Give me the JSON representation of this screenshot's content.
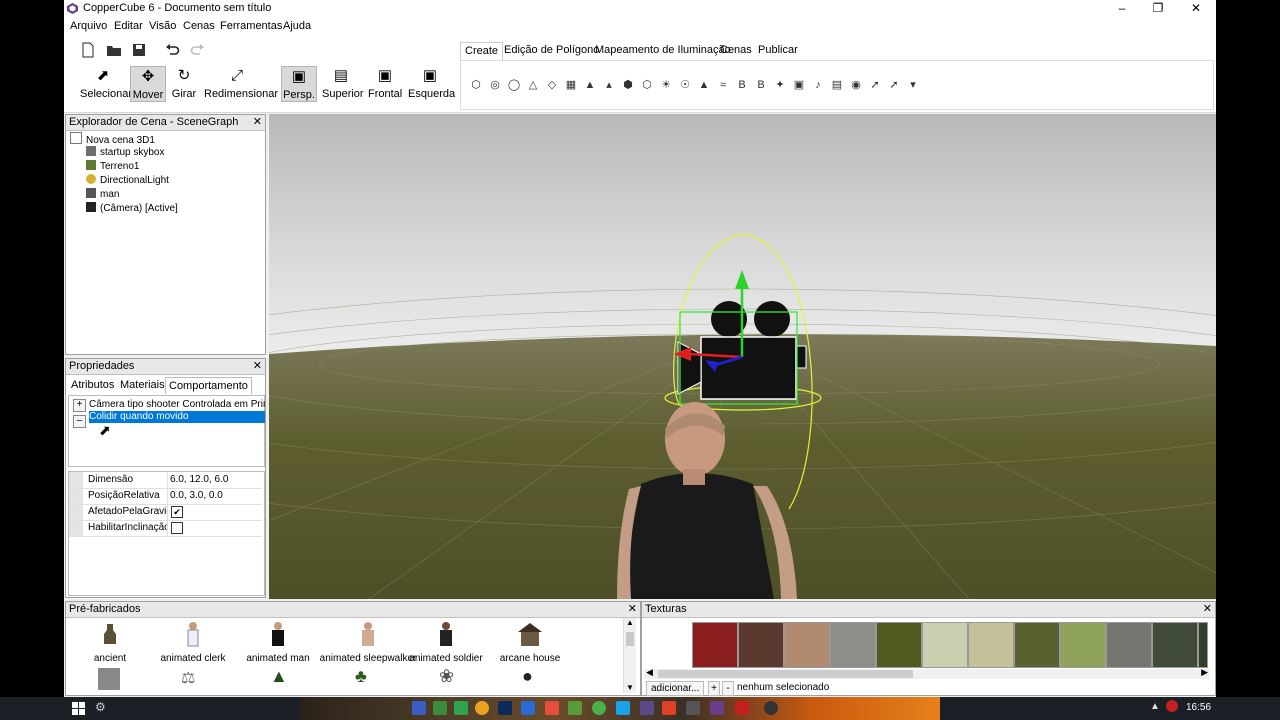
{
  "window": {
    "title": "CopperCube 6 - Documento sem título"
  },
  "menu": [
    "Arquivo",
    "Editar",
    "Visão",
    "Cenas",
    "Ferramentas",
    "Ajuda"
  ],
  "tools": [
    {
      "label": "Selecionar",
      "icon": "cursor-icon"
    },
    {
      "label": "Mover",
      "icon": "move-icon",
      "selected": true
    },
    {
      "label": "Girar",
      "icon": "rotate-icon"
    },
    {
      "label": "Redimensionar",
      "icon": "resize-icon"
    },
    {
      "label": "Persp.",
      "icon": "perspective-icon",
      "selected": true
    },
    {
      "label": "Superior",
      "icon": "top-view-icon"
    },
    {
      "label": "Frontal",
      "icon": "front-view-icon"
    },
    {
      "label": "Esquerda",
      "icon": "left-view-icon"
    }
  ],
  "ribbon_tabs": [
    "Create",
    "Edição de Polígono",
    "Mapeamento de Iluminação",
    "Cenas",
    "Publicar"
  ],
  "ribbon_active": "Create",
  "scene_explorer": {
    "title": "Explorador de Cena - SceneGraph",
    "items": [
      "Nova cena 3D1",
      "startup skybox",
      "Terreno1",
      "DirectionalLight",
      "man",
      "(Câmera) [Active]"
    ]
  },
  "properties": {
    "title": "Propriedades",
    "tabs": [
      "Atributos",
      "Materiais",
      "Comportamento"
    ],
    "active_tab": "Comportamento",
    "behaviors": [
      "Câmera tipo shooter Controlada em Prim",
      "Colidir quando movido"
    ],
    "selected_behavior": "Colidir quando movido",
    "rows": [
      {
        "key": "Dimensão",
        "value": "6.0, 12.0, 6.0"
      },
      {
        "key": "PosiçãoRelativa",
        "value": "0.0, 3.0, 0.0"
      },
      {
        "key": "AfetadoPelaGravid",
        "checked": true
      },
      {
        "key": "HabilitarInclinação",
        "checked": false
      }
    ]
  },
  "prefabs": {
    "title": "Pré-fabricados",
    "items": [
      "ancient",
      "animated clerk",
      "animated man",
      "animated sleepwalker",
      "animated soldier",
      "arcane house"
    ],
    "selected": "animated man"
  },
  "textures": {
    "title": "Texturas",
    "add_button": "adicionar...",
    "plus": "+",
    "minus": "-",
    "status": "nenhum selecionado"
  },
  "taskbar": {
    "time": "16:56"
  },
  "colors": {
    "accent": "#0078d7",
    "sky": "#c9c9c9",
    "ground": "#5a5c2c"
  }
}
